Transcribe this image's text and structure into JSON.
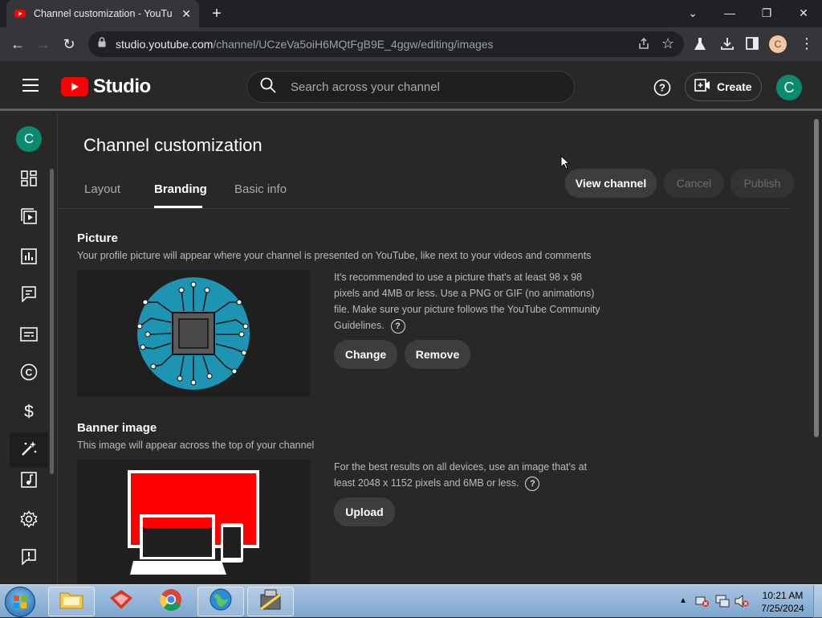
{
  "browser": {
    "tab_title": "Channel customization - YouTub",
    "url_domain": "studio.youtube.com",
    "url_path": "/channel/UCzeVa5oiH6MQtFgB9E_4ggw/editing/images",
    "profile_initial": "C"
  },
  "header": {
    "logo_text": "Studio",
    "search_placeholder": "Search across your channel",
    "create_label": "Create",
    "avatar_initial": "C"
  },
  "sidebar": {
    "avatar_initial": "C"
  },
  "page": {
    "title": "Channel customization",
    "tabs": [
      {
        "label": "Layout"
      },
      {
        "label": "Branding"
      },
      {
        "label": "Basic info"
      }
    ],
    "view_channel_label": "View channel",
    "cancel_label": "Cancel",
    "publish_label": "Publish"
  },
  "picture": {
    "title": "Picture",
    "description": "Your profile picture will appear where your channel is presented on YouTube, like next to your videos and comments",
    "info": "It's recommended to use a picture that's at least 98 x 98 pixels and 4MB or less. Use a PNG or GIF (no animations) file. Make sure your picture follows the YouTube Community Guidelines.",
    "change_label": "Change",
    "remove_label": "Remove"
  },
  "banner": {
    "title": "Banner image",
    "description": "This image will appear across the top of your channel",
    "info": "For the best results on all devices, use an image that's at least 2048 x 1152 pixels and 6MB or less.",
    "upload_label": "Upload"
  },
  "taskbar": {
    "time": "10:21 AM",
    "date": "7/25/2024"
  },
  "colors": {
    "brand_red": "#ff0000",
    "avatar_teal": "#0b8a6e",
    "chip_blue": "#1e94b3"
  }
}
